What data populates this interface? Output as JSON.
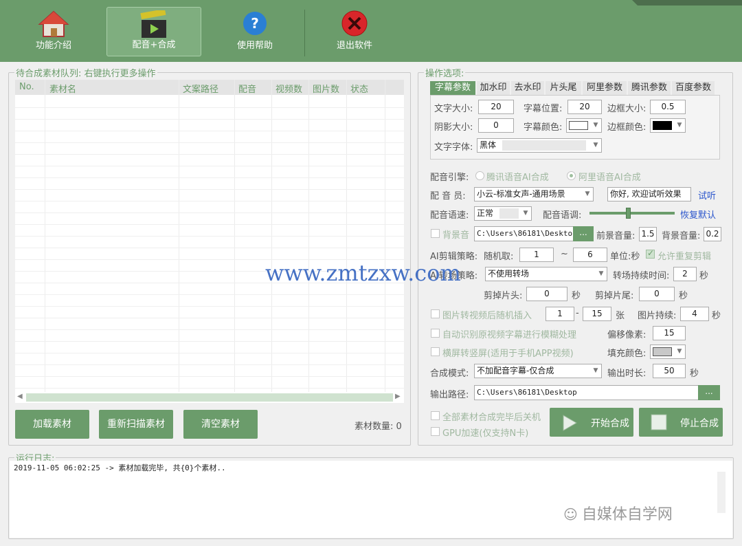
{
  "toolbar": {
    "intro": "功能介绍",
    "dub": "配音+合成",
    "help": "使用帮助",
    "exit": "退出软件"
  },
  "queue": {
    "title": "待合成素材队列: 右键执行更多操作",
    "columns": [
      "No.",
      "素材名",
      "文案路径",
      "配音",
      "视频数",
      "图片数",
      "状态"
    ],
    "load": "加载素材",
    "rescan": "重新扫描素材",
    "clear": "清空素材",
    "count_label": "素材数量: 0"
  },
  "options": {
    "title": "操作选项:",
    "tabs": [
      "字幕参数",
      "加水印",
      "去水印",
      "片头尾",
      "阿里参数",
      "腾讯参数",
      "百度参数"
    ],
    "subtitle": {
      "font_size_label": "文字大小:",
      "font_size": "20",
      "pos_label": "字幕位置:",
      "pos": "20",
      "border_size_label": "边框大小:",
      "border_size": "0.5",
      "shadow_label": "阴影大小:",
      "shadow": "0",
      "color_label": "字幕颜色:",
      "border_color_label": "边框颜色:",
      "font_label": "文字字体:",
      "font": "黑体"
    },
    "engine_label": "配音引擎:",
    "engine_tencent": "腾讯语音AI合成",
    "engine_ali": "阿里语音AI合成",
    "voice_label": "配 音 员:",
    "voice": "小云-标准女声-通用场景",
    "preview_text": "你好, 欢迎试听效果",
    "try_link": "试听",
    "speed_label": "配音语速:",
    "speed": "正常",
    "tone_label": "配音语调:",
    "tone_level": 0.45,
    "restore_link": "恢复默认",
    "bgm_label": "背景音",
    "bgm_path": "C:\\Users\\86181\\Desktop",
    "fg_vol_label": "前景音量:",
    "fg_vol": "1.5",
    "bg_vol_label": "背景音量:",
    "bg_vol": "0.2",
    "ai_cut_label": "AI剪辑策略:",
    "random_label": "随机取:",
    "rand_min": "1",
    "dash": "~",
    "rand_max": "6",
    "unit_label": "单位:秒",
    "allow_repeat": "允许重复剪辑",
    "trans_label": "AI转场策略:",
    "trans": "不使用转场",
    "trans_dur_label": "转场持续时间:",
    "trans_dur": "2",
    "sec": "秒",
    "cut_head_label": "剪掉片头:",
    "cut_head": "0",
    "cut_tail_label": "剪掉片尾:",
    "cut_tail": "0",
    "img_insert_label": "图片转视频后随机插入",
    "img_min": "1",
    "img_dash": "-",
    "img_max": "15",
    "img_unit": "张",
    "img_dur_label": "图片持续:",
    "img_dur": "4",
    "auto_blur_label": "自动识别原视频字幕进行模糊处理",
    "offset_label": "偏移像素:",
    "offset": "15",
    "rotate_label": "横屏转竖屏(适用于手机APP视频)",
    "fill_label": "填充颜色:",
    "mode_label": "合成模式:",
    "mode": "不加配音字幕-仅合成",
    "out_dur_label": "输出时长:",
    "out_dur": "50",
    "out_path_label": "输出路径:",
    "out_path": "C:\\Users\\86181\\Desktop",
    "dots": "...",
    "shutdown_label": "全部素材合成完毕后关机",
    "gpu_label": "GPU加速(仅支持N卡)",
    "start": "开始合成",
    "stop": "停止合成"
  },
  "log": {
    "title": "运行日志:",
    "line": "2019-11-05 06:02:25 -> 素材加载完毕, 共{0}个素材.."
  },
  "overlays": {
    "watermark": "www.zmtzxw.com",
    "wechat": "自媒体自学网"
  },
  "colors": {
    "accent": "#6b9c6b",
    "link": "#2a55cc",
    "watermark": "#4671c4"
  }
}
